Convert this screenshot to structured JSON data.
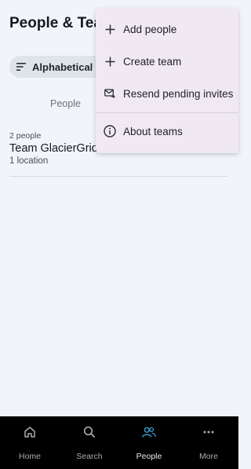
{
  "header": {
    "title": "People & Tea"
  },
  "sort": {
    "label": "Alphabetical"
  },
  "tabs": {
    "people": "People"
  },
  "team": {
    "count": "2 people",
    "name": "Team GlacierGrid",
    "location": "1 location"
  },
  "menu": {
    "items": [
      {
        "label": "Add people",
        "icon": "plus-icon"
      },
      {
        "label": "Create team",
        "icon": "plus-icon"
      },
      {
        "label": "Resend pending invites",
        "icon": "mail-resend-icon"
      },
      {
        "label": "About teams",
        "icon": "info-icon"
      }
    ]
  },
  "nav": {
    "items": [
      {
        "label": "Home",
        "icon": "home-icon"
      },
      {
        "label": "Search",
        "icon": "search-icon"
      },
      {
        "label": "People",
        "icon": "people-icon",
        "active": true
      },
      {
        "label": "More",
        "icon": "more-icon"
      }
    ]
  },
  "colors": {
    "background": "#f1f4f8",
    "menu_background": "#f0e9f4",
    "nav_background": "#000000",
    "active_accent": "#3f9fd0"
  }
}
